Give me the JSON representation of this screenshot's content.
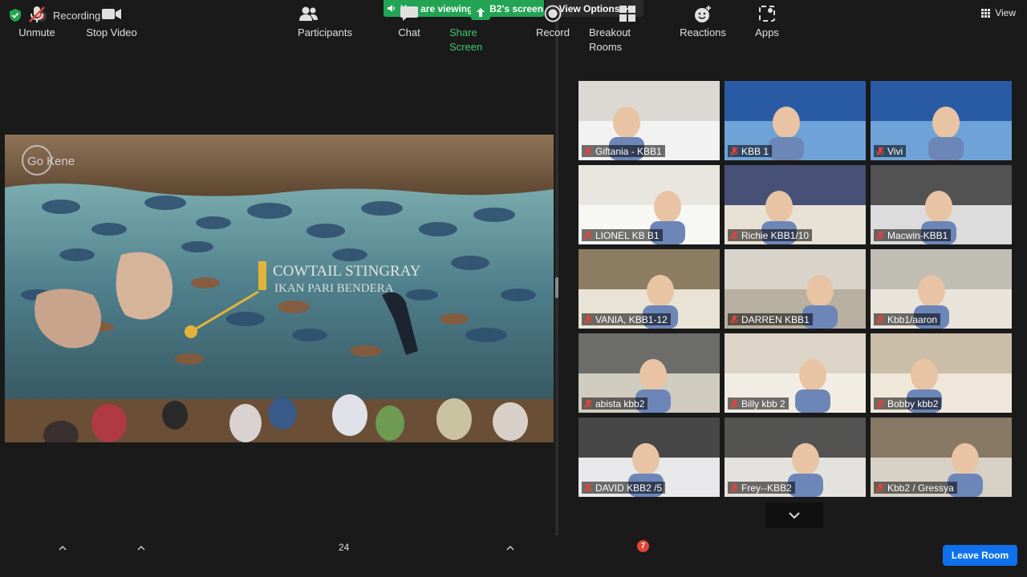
{
  "status": {
    "recording_label": "Recording",
    "viewing_banner": "You are viewing KBB2's screen",
    "view_options_label": "View Options",
    "view_label": "View"
  },
  "shared_screen": {
    "watermark": "Go Kene",
    "caption_line1": "COWTAIL STINGRAY",
    "caption_line2": "IKAN PARI BENDERA"
  },
  "participants": [
    {
      "name": "Giftania - KBB1",
      "muted": true,
      "active": false
    },
    {
      "name": "KBB 1",
      "muted": true,
      "active": false
    },
    {
      "name": "Vivi",
      "muted": true,
      "active": false
    },
    {
      "name": "LIONEL KB B1",
      "muted": true,
      "active": false
    },
    {
      "name": "Richie KBB1/10",
      "muted": true,
      "active": true
    },
    {
      "name": "Macwin-KBB1",
      "muted": true,
      "active": false
    },
    {
      "name": "VANIA, KBB1-12",
      "muted": true,
      "active": false
    },
    {
      "name": "DARREN KBB1",
      "muted": true,
      "active": false
    },
    {
      "name": "Kbb1/aaron",
      "muted": true,
      "active": false
    },
    {
      "name": "abista kbb2",
      "muted": true,
      "active": false
    },
    {
      "name": "Billy kbb 2",
      "muted": true,
      "active": false
    },
    {
      "name": "Bobby kbb2",
      "muted": true,
      "active": false
    },
    {
      "name": "DAVID KBB2 /5",
      "muted": true,
      "active": false
    },
    {
      "name": "Frey--KBB2",
      "muted": true,
      "active": false
    },
    {
      "name": "Kbb2 / Gressya",
      "muted": true,
      "active": false
    }
  ],
  "toolbar": {
    "unmute": "Unmute",
    "stop_video": "Stop Video",
    "participants": "Participants",
    "participant_count": "24",
    "chat": "Chat",
    "share_screen": "Share Screen",
    "record": "Record",
    "breakout_rooms": "Breakout Rooms",
    "breakout_badge": "7",
    "reactions": "Reactions",
    "apps": "Apps",
    "leave_room": "Leave Room"
  },
  "colors": {
    "share_green": "#23a455",
    "leave_blue": "#0e71eb",
    "mute_red": "#e0453b",
    "active_speaker": "#d8e05a"
  }
}
